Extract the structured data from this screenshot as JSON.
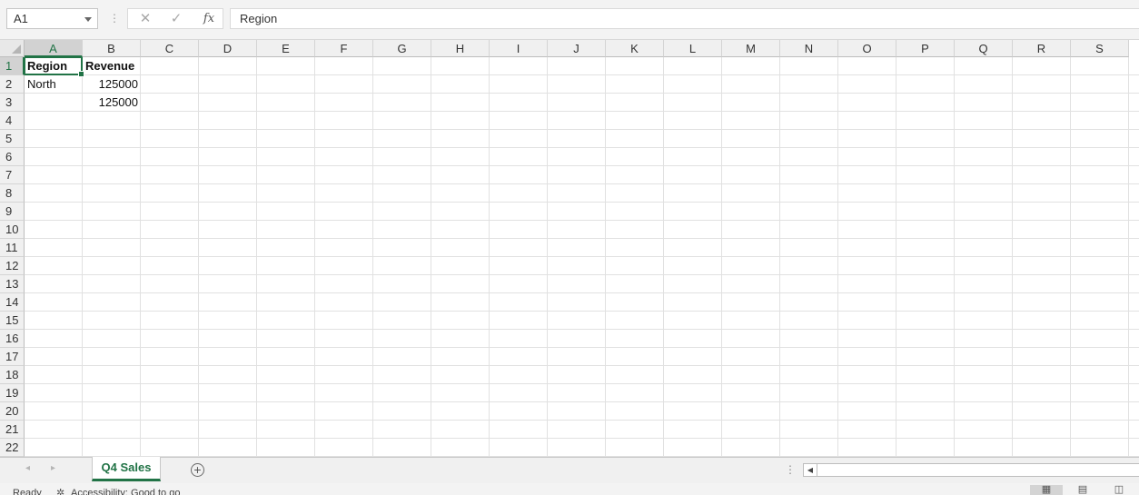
{
  "formula_bar": {
    "name_box": "A1",
    "cancel_icon": "✕",
    "enter_icon": "✓",
    "fx_label": "fx",
    "content": "Region"
  },
  "columns": [
    "A",
    "B",
    "C",
    "D",
    "E",
    "F",
    "G",
    "H",
    "I",
    "J",
    "K",
    "L",
    "M",
    "N",
    "O",
    "P",
    "Q",
    "R",
    "S"
  ],
  "rows": [
    "1",
    "2",
    "3",
    "4",
    "5",
    "6",
    "7",
    "8",
    "9",
    "10",
    "11",
    "12",
    "13",
    "14",
    "15",
    "16",
    "17",
    "18",
    "19",
    "20",
    "21",
    "22"
  ],
  "selected_cell": {
    "column": "A",
    "row": "1"
  },
  "cells": [
    {
      "ref": "A1",
      "col": 0,
      "row": 0,
      "value": "Region",
      "bold": true,
      "align": "left"
    },
    {
      "ref": "B1",
      "col": 1,
      "row": 0,
      "value": "Revenue",
      "bold": true,
      "align": "left"
    },
    {
      "ref": "A2",
      "col": 0,
      "row": 1,
      "value": "North",
      "bold": false,
      "align": "left"
    },
    {
      "ref": "B2",
      "col": 1,
      "row": 1,
      "value": "125000",
      "bold": false,
      "align": "right"
    },
    {
      "ref": "B3",
      "col": 1,
      "row": 2,
      "value": "125000",
      "bold": false,
      "align": "right"
    }
  ],
  "sheet_tabs": [
    {
      "label": "Q4 Sales",
      "active": true
    }
  ],
  "sheet_nav": {
    "prev": "◂",
    "next": "▸",
    "add": "+"
  },
  "statusbar": {
    "ready": "Ready",
    "accessibility": "Accessibility: Good to go"
  },
  "colors": {
    "accent": "#217346",
    "grid_line": "#e1e1e1",
    "header_bg": "#f0f0f0"
  },
  "icons": {
    "cancel": "close-icon",
    "enter": "check-icon",
    "function": "fx-icon",
    "add_sheet": "plus-circle-icon",
    "accessibility": "accessibility-icon"
  }
}
